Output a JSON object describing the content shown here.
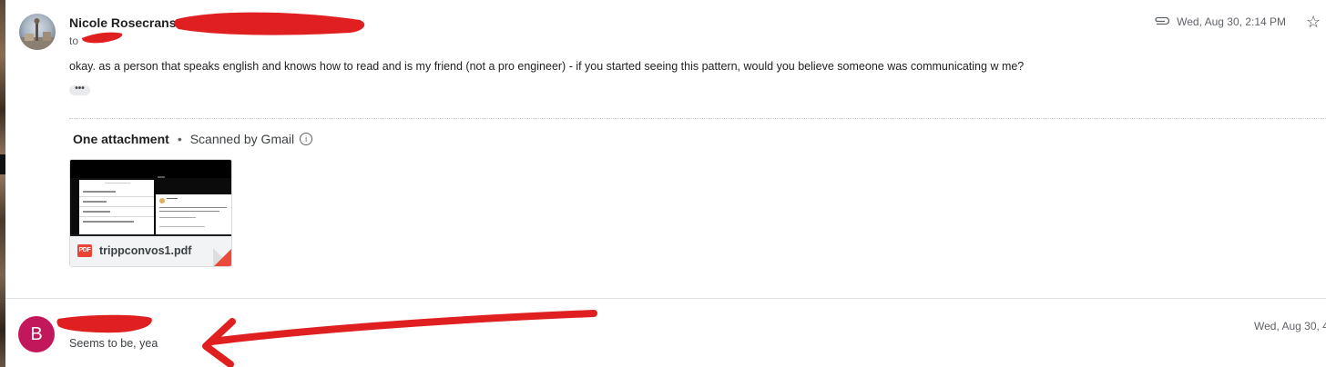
{
  "message1": {
    "sender_name": "Nicole Rosecrans",
    "to_label": "to",
    "attachment_icon": "paperclip-icon",
    "date": "Wed, Aug 30, 2:14 PM",
    "star_icon": "star-icon",
    "body": "okay. as a person that speaks english and knows how to read and is my friend (not a pro engineer) - if you started seeing this pattern, would you believe someone was communicating w me?",
    "trimmed_content_label": "•••",
    "attachments_header": {
      "count_label": "One attachment",
      "separator": "•",
      "scanned_label": "Scanned by Gmail",
      "info_icon": "i"
    },
    "attachment": {
      "type_label": "PDF",
      "file_name": "trippconvos1.pdf"
    }
  },
  "message2": {
    "avatar_letter": "B",
    "avatar_color": "#c2185b",
    "reply_text": "Seems to be, yea",
    "date": "Wed, Aug 30, 4"
  },
  "colors": {
    "annotation_red": "#e02020",
    "pdf_red": "#ea4335"
  }
}
